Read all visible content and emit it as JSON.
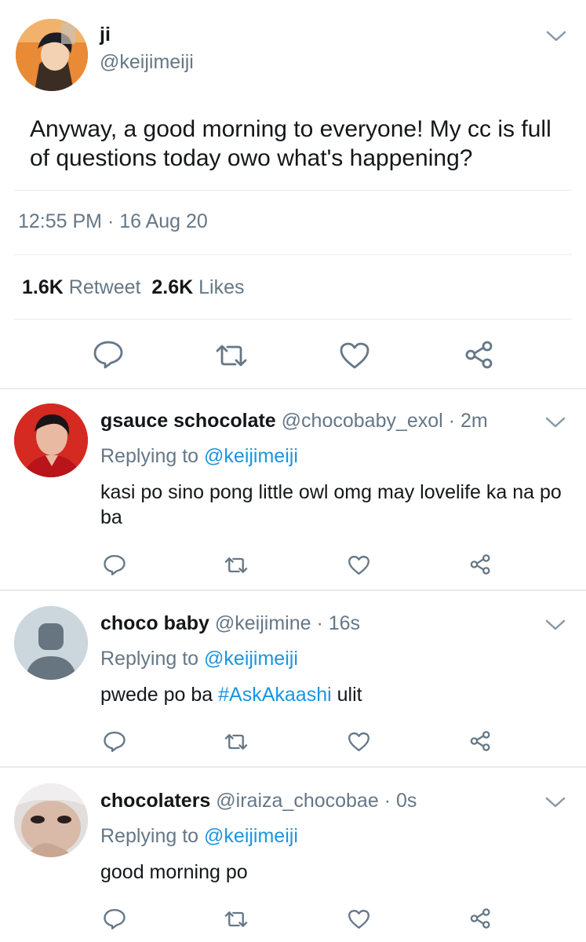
{
  "main_tweet": {
    "name": "ji",
    "handle": "@keijimeiji",
    "text": "Anyway, a good morning to everyone! My cc is full of questions today owo what's happening?",
    "timestamp": "12:55 PM · 16 Aug 20",
    "retweets_count": "1.6K",
    "retweets_label": "Retweet",
    "likes_count": "2.6K",
    "likes_label": "Likes"
  },
  "replies": [
    {
      "name": "gsauce schocolate",
      "handle": "@chocobaby_exol",
      "time": "· 2m",
      "replying_prefix": "Replying to",
      "replying_handle": "@keijimeiji",
      "text": "kasi po sino pong little owl omg may lovelife ka na po ba"
    },
    {
      "name": "choco baby",
      "handle": "@keijimine",
      "time": "· 16s",
      "replying_prefix": "Replying to",
      "replying_handle": "@keijimeiji",
      "text_before": "pwede po ba",
      "hashtag": "#AskAkaashi",
      "text_after": "ulit"
    },
    {
      "name": "chocolaters",
      "handle": "@iraiza_chocobae",
      "time": "· 0s",
      "replying_prefix": "Replying to",
      "replying_handle": "@keijimeiji",
      "text": "good morning po"
    }
  ],
  "icons": {
    "reply": "speech-bubble-icon",
    "retweet": "retweet-arrows-icon",
    "like": "heart-icon",
    "share": "share-nodes-icon",
    "menu": "chevron-down-icon"
  },
  "colors": {
    "text": "#14171a",
    "secondary": "#657786",
    "link": "#1b95e0",
    "divider": "#e6ecf0"
  }
}
